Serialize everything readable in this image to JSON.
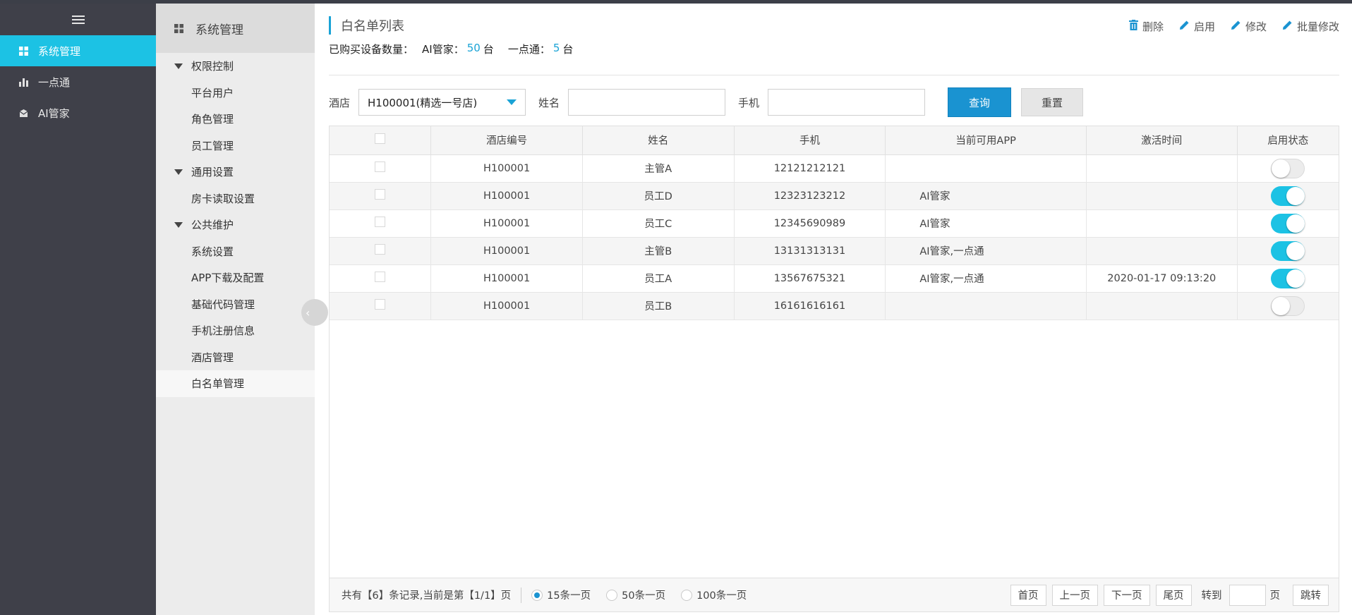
{
  "sidebar": {
    "items": [
      {
        "label": "系统管理",
        "icon": "grid-icon"
      },
      {
        "label": "一点通",
        "icon": "bar-chart-icon"
      },
      {
        "label": "AI管家",
        "icon": "mailbox-icon"
      }
    ]
  },
  "submenu": {
    "header": "系统管理",
    "groups": [
      {
        "label": "权限控制",
        "items": [
          "平台用户",
          "角色管理",
          "员工管理"
        ]
      },
      {
        "label": "通用设置",
        "items": [
          "房卡读取设置"
        ]
      },
      {
        "label": "公共维护",
        "items": [
          "系统设置",
          "APP下载及配置",
          "基础代码管理",
          "手机注册信息",
          "酒店管理",
          "白名单管理"
        ]
      }
    ]
  },
  "page": {
    "title": "白名单列表",
    "summary_label": "已购买设备数量：",
    "ai_label": "AI管家：",
    "ai_count": "50",
    "yidian_label": "一点通：",
    "yidian_count": "5",
    "unit": "台"
  },
  "toolbar": {
    "delete": "删除",
    "enable": "启用",
    "edit": "修改",
    "batch_edit": "批量修改"
  },
  "filters": {
    "hotel_label": "酒店",
    "hotel_value": "H100001(精选一号店)",
    "name_label": "姓名",
    "phone_label": "手机",
    "query": "查询",
    "reset": "重置"
  },
  "table": {
    "headers": [
      "酒店编号",
      "姓名",
      "手机",
      "当前可用APP",
      "激活时间",
      "启用状态"
    ],
    "rows": [
      {
        "hotel": "H100001",
        "name": "主管A",
        "phone": "12121212121",
        "app": "",
        "time": "",
        "enabled": false
      },
      {
        "hotel": "H100001",
        "name": "员工D",
        "phone": "12323123212",
        "app": "AI管家",
        "time": "",
        "enabled": true
      },
      {
        "hotel": "H100001",
        "name": "员工C",
        "phone": "12345690989",
        "app": "AI管家",
        "time": "",
        "enabled": true
      },
      {
        "hotel": "H100001",
        "name": "主管B",
        "phone": "13131313131",
        "app": "AI管家,一点通",
        "time": "",
        "enabled": true
      },
      {
        "hotel": "H100001",
        "name": "员工A",
        "phone": "13567675321",
        "app": "AI管家,一点通",
        "time": "2020-01-17 09:13:20",
        "enabled": true
      },
      {
        "hotel": "H100001",
        "name": "员工B",
        "phone": "16161616161",
        "app": "",
        "time": "",
        "enabled": false
      }
    ]
  },
  "pager": {
    "summary": "共有【6】条记录,当前是第【1/1】页",
    "sizes": [
      "15条一页",
      "50条一页",
      "100条一页"
    ],
    "first": "首页",
    "prev": "上一页",
    "next": "下一页",
    "last": "尾页",
    "goto": "转到",
    "page_unit": "页",
    "jump": "跳转"
  },
  "colors": {
    "accent": "#1cc2e4",
    "primary": "#1a93d1",
    "sidebar": "#3f4049"
  }
}
